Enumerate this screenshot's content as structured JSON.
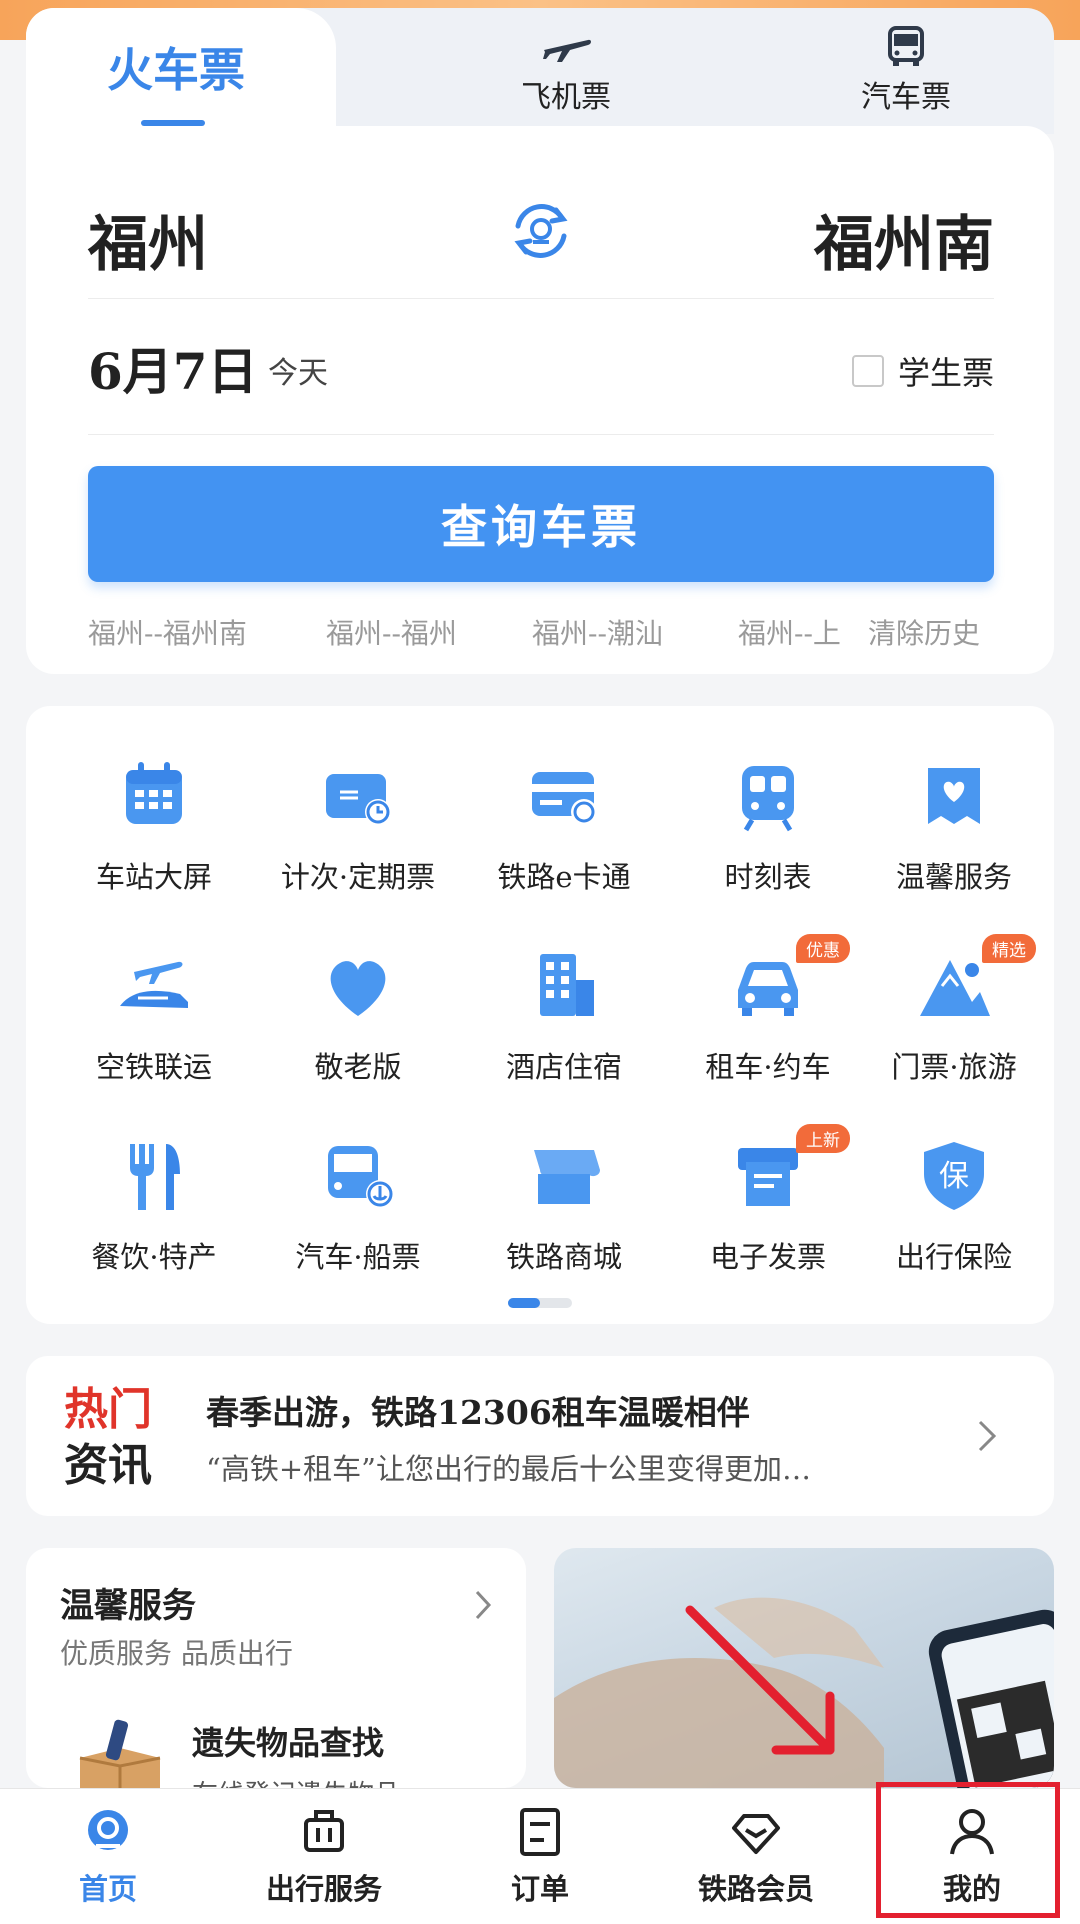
{
  "tabs": {
    "train": "火车票",
    "plane": "飞机票",
    "bus": "汽车票"
  },
  "route": {
    "from": "福州",
    "to": "福州南"
  },
  "date": {
    "value": "6月7日",
    "relative": "今天"
  },
  "student_ticket": "学生票",
  "query_button": "查询车票",
  "history": [
    "福州--福州南",
    "福州--福州",
    "福州--潮汕",
    "福州--上",
    "清除历史"
  ],
  "services": [
    {
      "label": "车站大屏",
      "icon": "calendar-icon"
    },
    {
      "label": "计次·定期票",
      "icon": "ticket-clock-icon"
    },
    {
      "label": "铁路e卡通",
      "icon": "card-icon"
    },
    {
      "label": "时刻表",
      "icon": "train-icon"
    },
    {
      "label": "温馨服务",
      "icon": "heart-box-icon"
    },
    {
      "label": "空铁联运",
      "icon": "plane-train-icon"
    },
    {
      "label": "敬老版",
      "icon": "heart-icon"
    },
    {
      "label": "酒店住宿",
      "icon": "hotel-icon"
    },
    {
      "label": "租车·约车",
      "icon": "car-icon",
      "badge": "优惠"
    },
    {
      "label": "门票·旅游",
      "icon": "mountain-icon",
      "badge": "精选"
    },
    {
      "label": "餐饮·特产",
      "icon": "cutlery-icon"
    },
    {
      "label": "汽车·船票",
      "icon": "bus-anchor-icon"
    },
    {
      "label": "铁路商城",
      "icon": "shop-icon"
    },
    {
      "label": "电子发票",
      "icon": "invoice-icon",
      "badge": "上新"
    },
    {
      "label": "出行保险",
      "icon": "shield-bao-icon"
    }
  ],
  "insurance_glyph": "保",
  "news": {
    "logo_line1": "热门",
    "logo_line2": "资讯",
    "title": "春季出游，铁路12306租车温暖相伴",
    "subtitle": "“高铁+租车”让您出行的最后十公里变得更加…"
  },
  "warm_service": {
    "title": "温馨服务",
    "subtitle": "优质服务 品质出行",
    "item_title": "遗失物品查找",
    "item_subtitle": "在线登记遗失物品"
  },
  "tabbar": [
    {
      "label": "首页",
      "active": true
    },
    {
      "label": "出行服务",
      "active": false
    },
    {
      "label": "订单",
      "active": false
    },
    {
      "label": "铁路会员",
      "active": false
    },
    {
      "label": "我的",
      "active": false
    }
  ],
  "colors": {
    "accent": "#3a86e8",
    "button": "#4393f2",
    "badge": "#f26b3a",
    "highlight": "#e3202f"
  }
}
